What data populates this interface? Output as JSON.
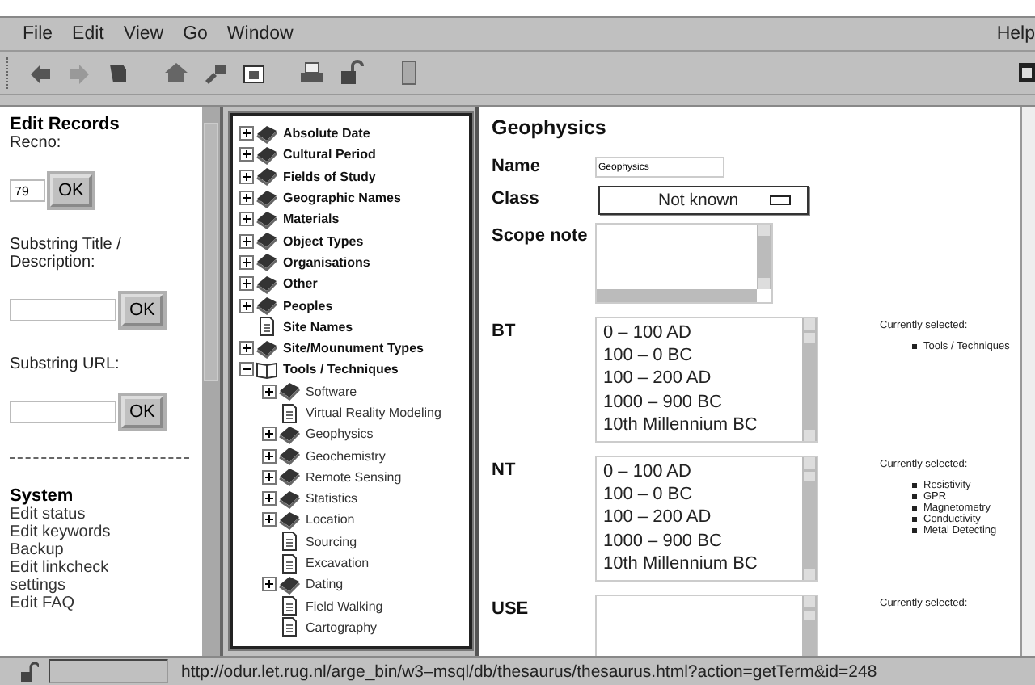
{
  "menu": {
    "items": [
      "File",
      "Edit",
      "View",
      "Go",
      "Window"
    ],
    "help": "Help"
  },
  "edit_panel": {
    "heading": "Edit Records",
    "fields": [
      {
        "label": "Recno:",
        "value": "79",
        "button": "OK"
      },
      {
        "label": "Substring Title / Description:",
        "button": "OK"
      },
      {
        "label": "Substring URL:",
        "button": "OK"
      }
    ],
    "system_heading": "System",
    "system_links": [
      "Edit status",
      "Edit keywords",
      "Backup",
      "Edit linkcheck settings",
      "Edit FAQ"
    ]
  },
  "tree": [
    {
      "label": "Absolute Date",
      "kind": "book",
      "expanded": false
    },
    {
      "label": "Cultural Period",
      "kind": "book",
      "expanded": false
    },
    {
      "label": "Fields of Study",
      "kind": "book",
      "expanded": false
    },
    {
      "label": "Geographic Names",
      "kind": "book",
      "expanded": false
    },
    {
      "label": "Materials",
      "kind": "book",
      "expanded": false
    },
    {
      "label": "Object Types",
      "kind": "book",
      "expanded": false
    },
    {
      "label": "Organisations",
      "kind": "book",
      "expanded": false
    },
    {
      "label": "Other",
      "kind": "book",
      "expanded": false
    },
    {
      "label": "Peoples",
      "kind": "book",
      "expanded": false
    },
    {
      "label": "Site Names",
      "kind": "page"
    },
    {
      "label": "Site/Mounument Types",
      "kind": "book",
      "expanded": false
    },
    {
      "label": "Tools / Techniques",
      "kind": "book",
      "expanded": true,
      "children": [
        {
          "label": "Software",
          "kind": "book",
          "expanded": false
        },
        {
          "label": "Virtual Reality Modeling",
          "kind": "page"
        },
        {
          "label": "Geophysics",
          "kind": "book",
          "expanded": false
        },
        {
          "label": "Geochemistry",
          "kind": "book",
          "expanded": false
        },
        {
          "label": "Remote Sensing",
          "kind": "book",
          "expanded": false
        },
        {
          "label": "Statistics",
          "kind": "book",
          "expanded": false
        },
        {
          "label": "Location",
          "kind": "book",
          "expanded": false
        },
        {
          "label": "Sourcing",
          "kind": "page"
        },
        {
          "label": "Excavation",
          "kind": "page"
        },
        {
          "label": "Dating",
          "kind": "book",
          "expanded": false
        },
        {
          "label": "Field Walking",
          "kind": "page"
        },
        {
          "label": "Cartography",
          "kind": "page"
        }
      ]
    }
  ],
  "record": {
    "title": "Geophysics",
    "name_label": "Name",
    "name_value": "Geophysics",
    "class_label": "Class",
    "class_value": "Not known",
    "scope_label": "Scope note",
    "relations": [
      {
        "label": "BT",
        "options": [
          "0 – 100 AD",
          "100 – 0 BC",
          "100 – 200 AD",
          "1000 – 900 BC",
          "10th Millennium BC"
        ],
        "selected_heading": "Currently selected:",
        "selected": [
          "Tools / Techniques"
        ]
      },
      {
        "label": "NT",
        "options": [
          "0 – 100 AD",
          "100 – 0 BC",
          "100 – 200 AD",
          "1000 – 900 BC",
          "10th Millennium BC"
        ],
        "selected_heading": "Currently selected:",
        "selected": [
          "Resistivity",
          "GPR",
          "Magnetometry",
          "Conductivity",
          "Metal Detecting"
        ]
      },
      {
        "label": "USE",
        "selected_heading": "Currently selected:"
      }
    ]
  },
  "status_bar": {
    "url": "http://odur.let.rug.nl/arge_bin/w3–msql/db/thesaurus/thesaurus.html?action=getTerm&id=248"
  }
}
